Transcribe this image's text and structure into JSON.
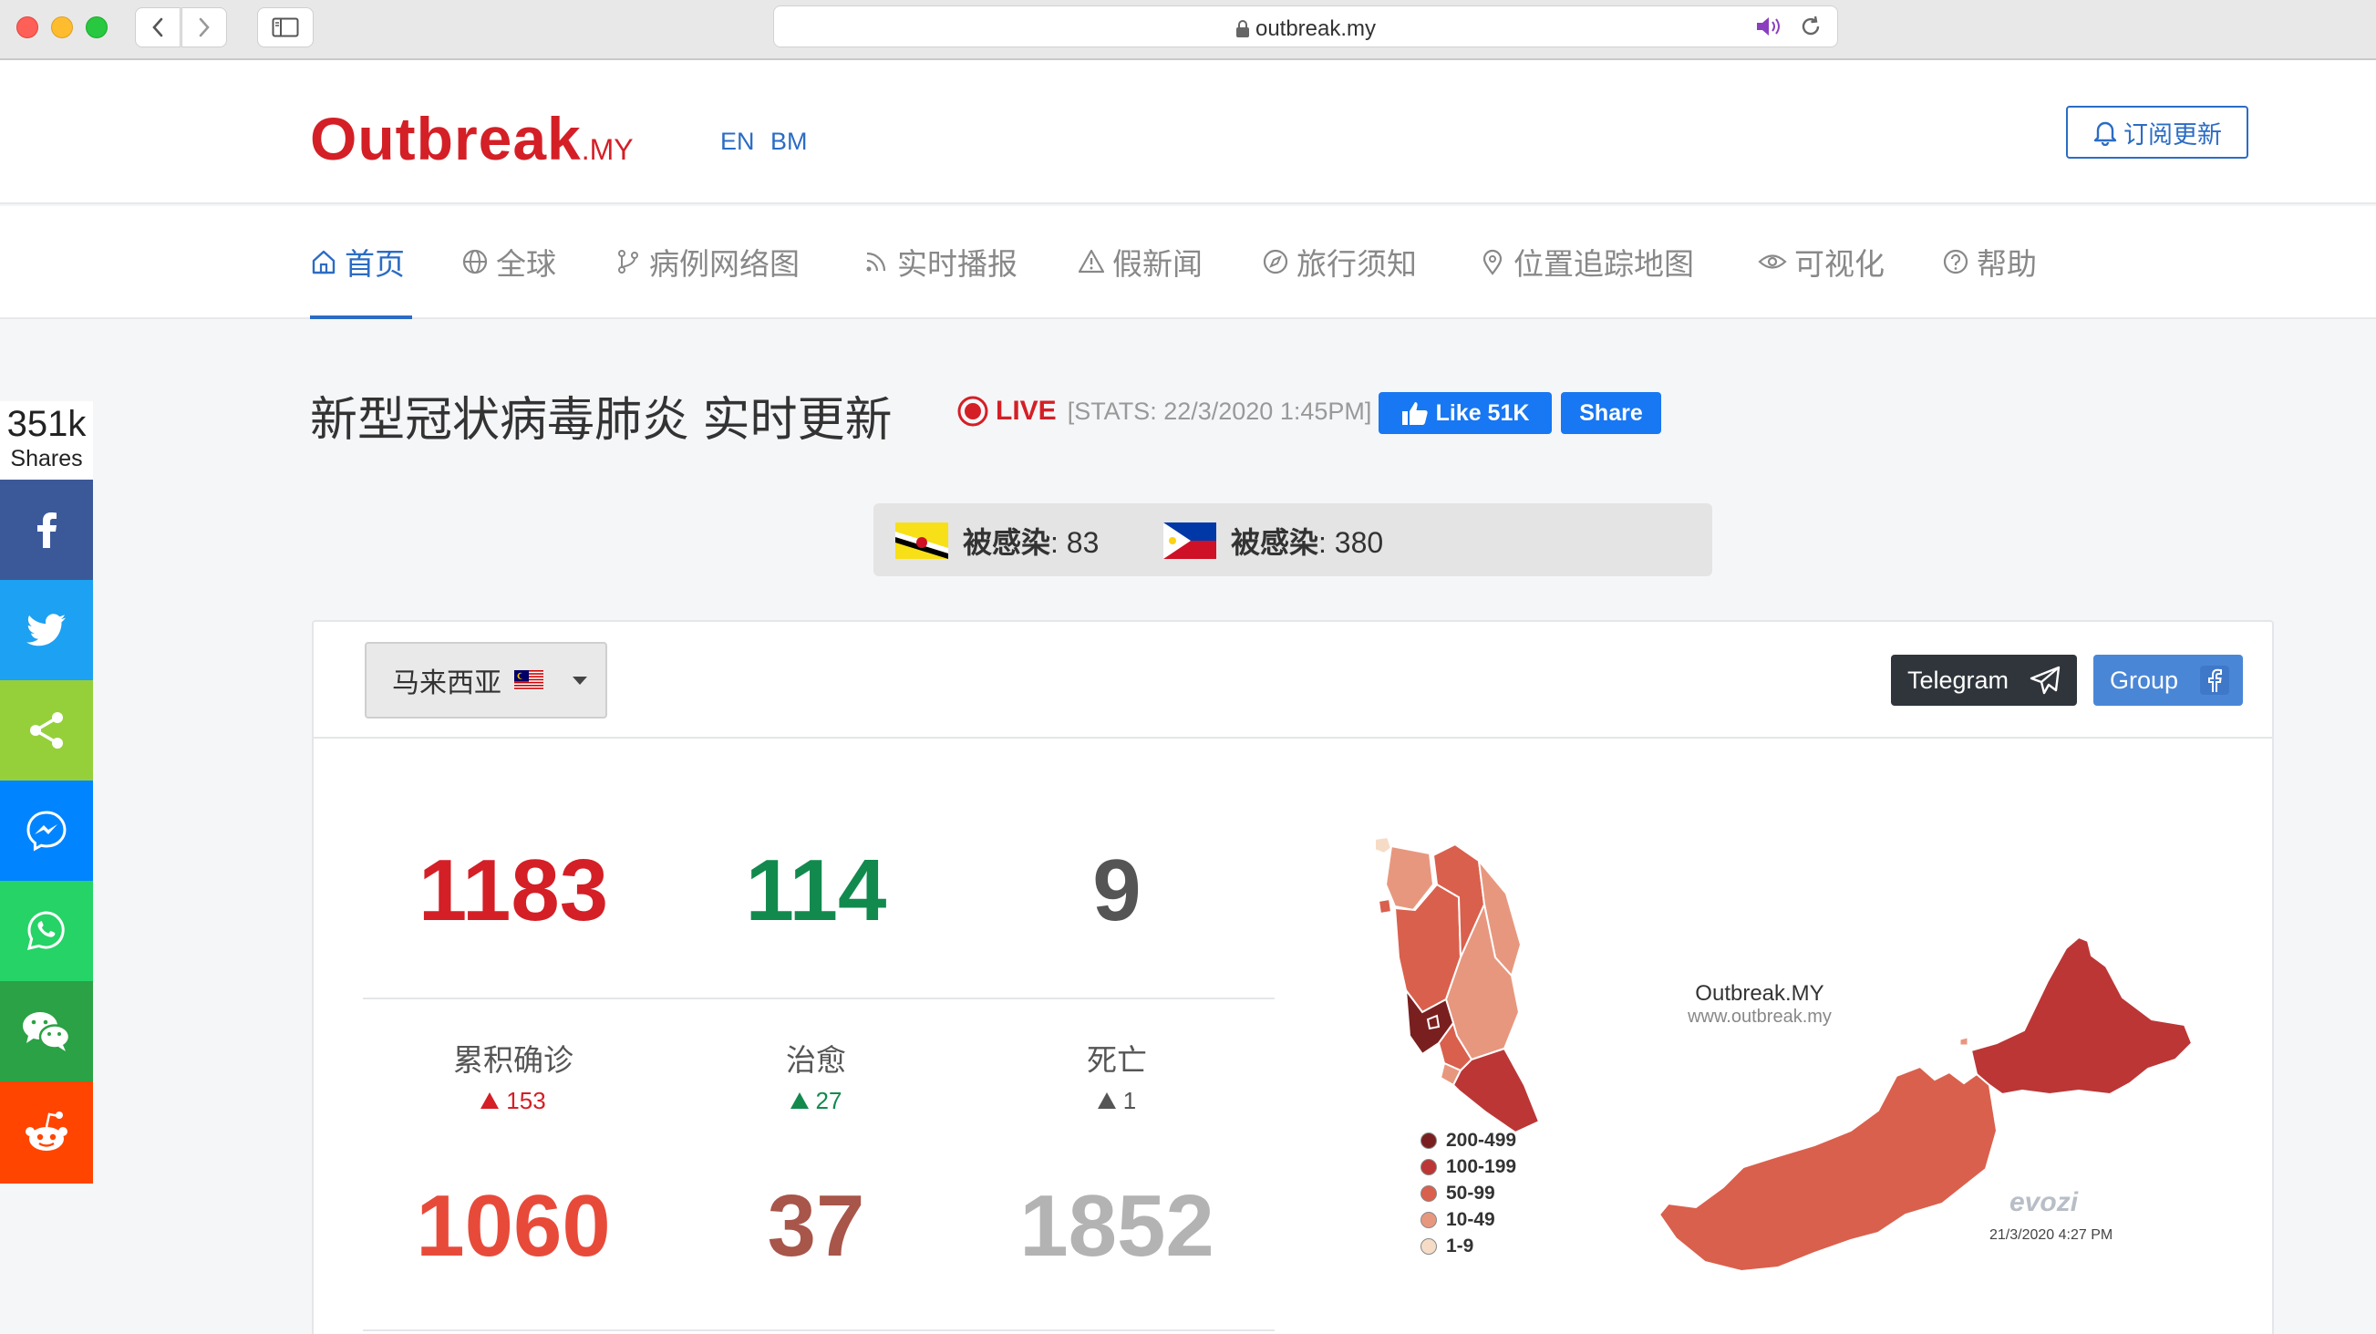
{
  "browser": {
    "url": "outbreak.my"
  },
  "header": {
    "logo_main": "Outbreak",
    "logo_suffix": ".MY",
    "lang_en": "EN",
    "lang_bm": "BM",
    "subscribe_label": "订阅更新"
  },
  "nav": {
    "items": [
      {
        "label": "首页",
        "icon": "home-icon",
        "active": true
      },
      {
        "label": "全球",
        "icon": "globe-icon"
      },
      {
        "label": "病例网络图",
        "icon": "branch-icon"
      },
      {
        "label": "实时播报",
        "icon": "rss-icon"
      },
      {
        "label": "假新闻",
        "icon": "warning-icon"
      },
      {
        "label": "旅行须知",
        "icon": "compass-icon"
      },
      {
        "label": "位置追踪地图",
        "icon": "map-pin-icon"
      },
      {
        "label": "可视化",
        "icon": "eye-icon"
      },
      {
        "label": "帮助",
        "icon": "help-icon"
      }
    ]
  },
  "social": {
    "count": "351k",
    "label": "Shares",
    "colors": {
      "facebook": "#3b5998",
      "twitter": "#1da1f2",
      "share": "#95d03a",
      "messenger": "#0084ff",
      "whatsapp": "#25d366",
      "wechat": "#2ba245",
      "reddit": "#ff4500"
    }
  },
  "title": {
    "text": "新型冠状病毒肺炎 实时更新",
    "live": "LIVE",
    "stats": "[STATS: 22/3/2020 1:45PM]",
    "fb_like": "Like 51K",
    "fb_share": "Share"
  },
  "infected": [
    {
      "label": "被感染",
      "value": ": 83",
      "flag": "brunei-flag"
    },
    {
      "label": "被感染",
      "value": ": 380",
      "flag": "philippines-flag"
    }
  ],
  "card": {
    "country": "马来西亚",
    "telegram": "Telegram",
    "group": "Group"
  },
  "stats": {
    "confirmed": {
      "value": "1183",
      "label": "累积确诊",
      "delta": "153",
      "color": "#d41f26"
    },
    "recovered": {
      "value": "114",
      "label": "治愈",
      "delta": "27",
      "color": "#128a4e"
    },
    "deaths": {
      "value": "9",
      "label": "死亡",
      "delta": "1",
      "color": "#555555"
    },
    "active": {
      "value": "1060",
      "color": "#e84a3a"
    },
    "critical": {
      "value": "37",
      "color": "#a8554a"
    },
    "pending": {
      "value": "1852",
      "color": "#b3b3b3"
    }
  },
  "map": {
    "brand": "Outbreak.MY",
    "url": "www.outbreak.my",
    "legend": [
      {
        "label": "200-499",
        "color": "#7a1f1f"
      },
      {
        "label": "100-199",
        "color": "#bc3636"
      },
      {
        "label": "50-99",
        "color": "#d9604d"
      },
      {
        "label": "10-49",
        "color": "#e8977f"
      },
      {
        "label": "1-9",
        "color": "#f6dcc6"
      }
    ],
    "watermark": "evozi",
    "date": "21/3/2020 4:27 PM"
  }
}
